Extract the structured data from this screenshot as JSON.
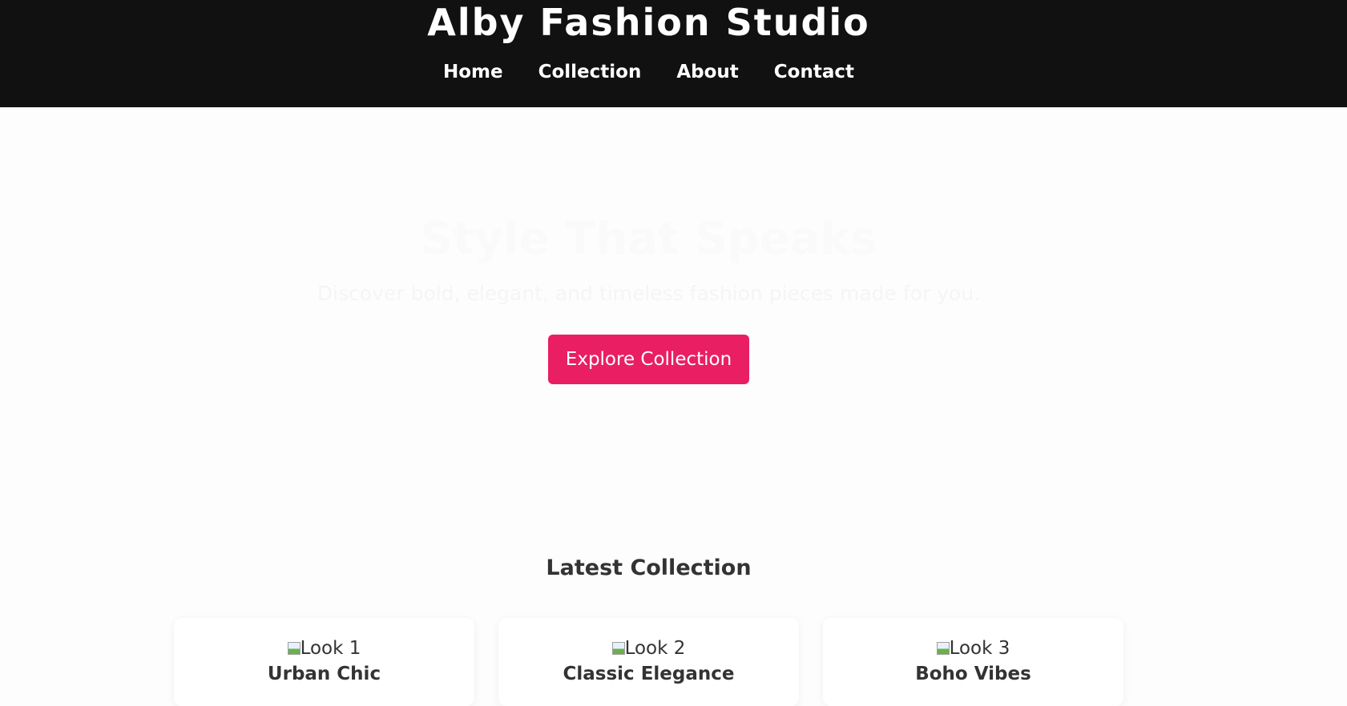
{
  "header": {
    "site_title": "Alby Fashion Studio",
    "nav": [
      "Home",
      "Collection",
      "About",
      "Contact"
    ]
  },
  "hero": {
    "title": "Style That Speaks",
    "subtitle": "Discover bold, elegant, and timeless fashion pieces made for you.",
    "cta_label": "Explore Collection"
  },
  "collection": {
    "heading": "Latest Collection",
    "items": [
      {
        "image_alt": "Look 1",
        "name": "Urban Chic"
      },
      {
        "image_alt": "Look 2",
        "name": "Classic Elegance"
      },
      {
        "image_alt": "Look 3",
        "name": "Boho Vibes"
      }
    ]
  },
  "colors": {
    "header_bg": "#111111",
    "accent": "#e91e63",
    "page_bg": "#fdfdfd"
  }
}
